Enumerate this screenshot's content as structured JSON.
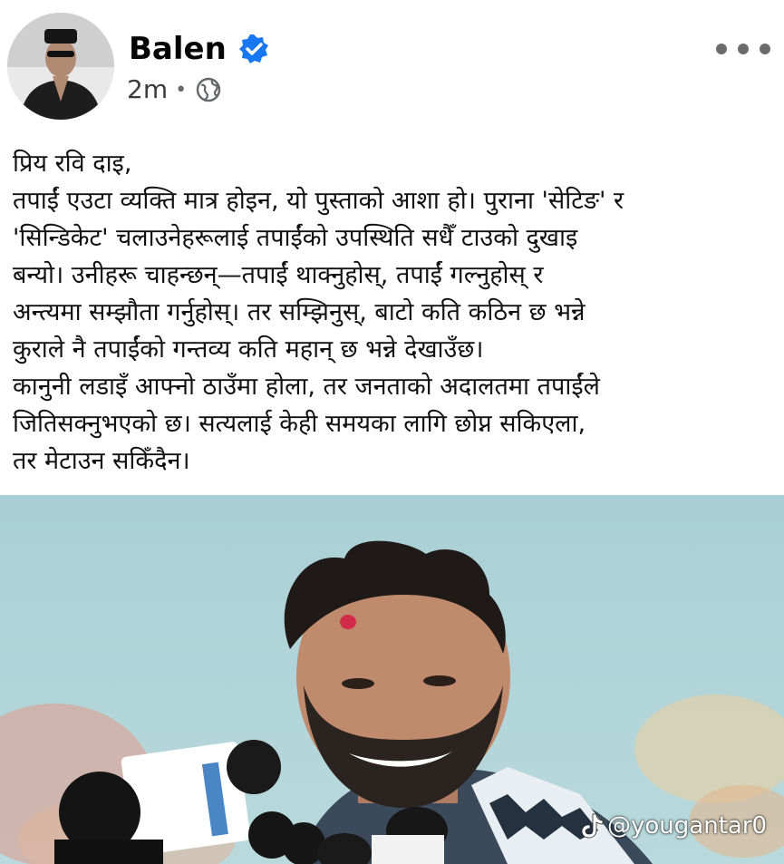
{
  "post": {
    "author": "Balen",
    "time": "2m",
    "separator": "•",
    "privacy_icon": "globe-icon",
    "verified_icon": "verified-badge-icon",
    "more_icon": "more-options-icon",
    "text_lines": [
      "प्रिय रवि दाइ,",
      "तपाईं एउटा व्यक्ति मात्र होइन, यो पुस्ताको आशा हो। पुराना 'सेटिङ' र",
      "'सिन्डिकेट' चलाउनेहरूलाई तपाईंको उपस्थिति सधैँ टाउको दुखाइ",
      "बन्यो। उनीहरू चाहन्छन्—तपाईं थाक्नुहोस्, तपाईं गल्नुहोस् र",
      "अन्त्यमा सम्झौता गर्नुहोस्। तर सम्झिनुस्, बाटो कति कठिन छ भन्ने",
      "कुराले नै तपाईंको गन्तव्य कति महान् छ भन्ने देखाउँछ।",
      "कानुनी लडाइँ आफ्नो ठाउँमा होला, तर जनताको अदालतमा तपाईंले",
      "जितिसक्नुभएको छ। सत्यलाई केही समयका लागि छोप्न सकिएला,",
      "तर मेटाउन सकिँदैन।"
    ]
  },
  "photo": {
    "description_icon": "post-photo",
    "watermark": "@yougantar0",
    "watermark_icon": "tiktok-icon"
  },
  "colors": {
    "verified": "#1877f2",
    "meta_gray": "#65676b",
    "sky": "#a9d0d6"
  }
}
